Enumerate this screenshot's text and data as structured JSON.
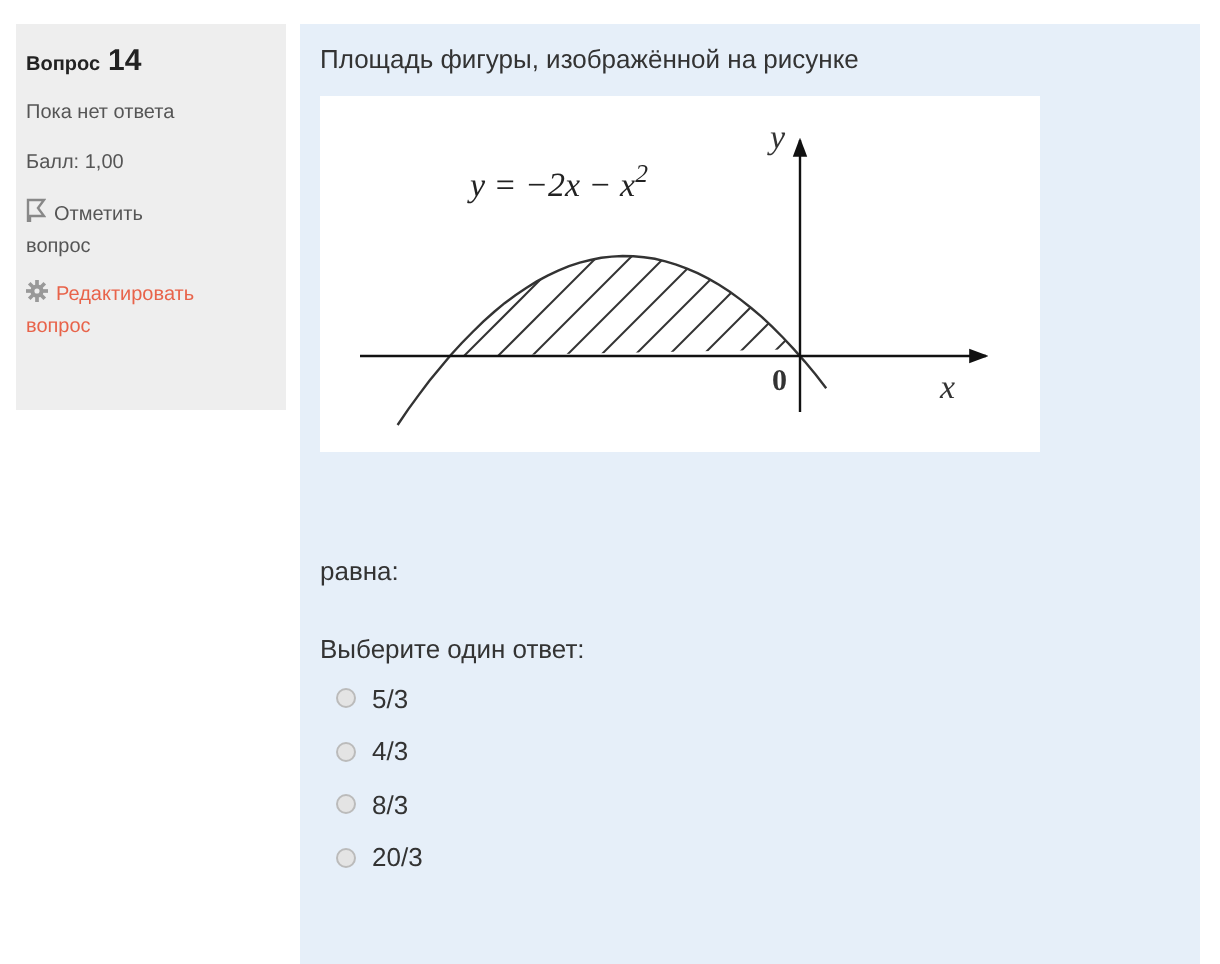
{
  "info": {
    "label": "Вопрос",
    "number": "14",
    "status": "Пока нет ответа",
    "grade": "Балл: 1,00",
    "flag": {
      "label": "Отметить вопрос",
      "flagged": false
    },
    "edit": "Редактировать вопрос"
  },
  "question": {
    "text": "Площадь фигуры, изображённой на рисунке",
    "figure": {
      "formula": "y = −2x − x$^{2}$",
      "y_axis": "y",
      "x_axis": "x",
      "origin": "0"
    },
    "continuation": "равна:",
    "prompt": "Выберите один ответ:",
    "options": [
      {
        "label": "5/3",
        "selected": false
      },
      {
        "label": "4/3",
        "selected": false
      },
      {
        "label": "8/3",
        "selected": false
      },
      {
        "label": "20/3",
        "selected": false
      }
    ]
  }
}
